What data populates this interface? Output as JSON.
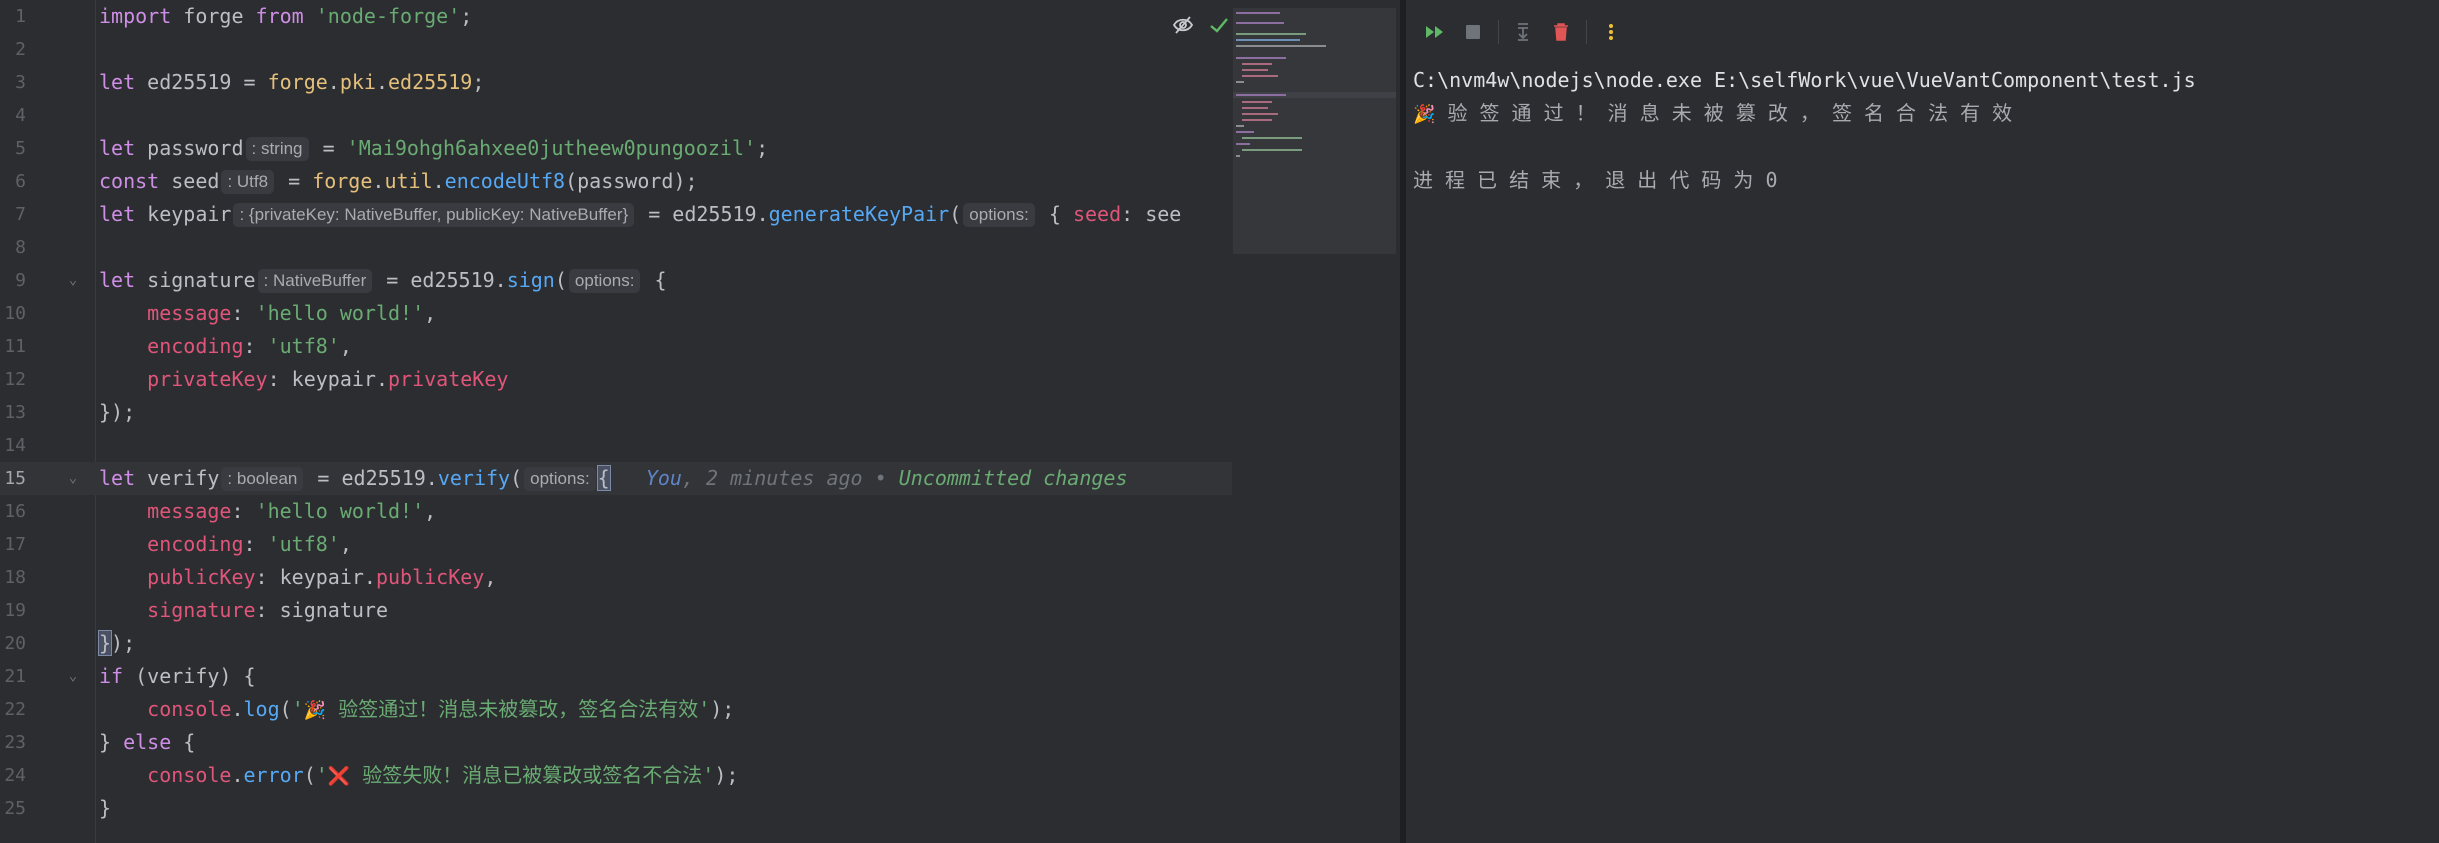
{
  "editor": {
    "line_numbers": [
      "1",
      "2",
      "3",
      "4",
      "5",
      "6",
      "7",
      "8",
      "9",
      "10",
      "11",
      "12",
      "13",
      "14",
      "15",
      "16",
      "17",
      "18",
      "19",
      "20",
      "21",
      "22",
      "23",
      "24",
      "25"
    ],
    "line1": {
      "kw1": "import",
      "id": " forge ",
      "kw2": "from",
      "sp": " ",
      "str": "'node-forge'",
      "end": ";"
    },
    "line3": {
      "kw": "let",
      "id": " ed25519 = ",
      "obj": "forge",
      "dot": ".",
      "prop1": "pki",
      "dot2": ".",
      "prop2": "ed25519",
      "end": ";"
    },
    "line5": {
      "kw": "let",
      "id": " password",
      "hint": ": string",
      "eq": " = ",
      "str": "'Mai9ohgh6ahxee0jutheew0pungoozil'",
      "end": ";"
    },
    "line6": {
      "kw": "const",
      "id": " seed",
      "hint": ": Utf8",
      "eq": " = ",
      "obj": "forge",
      "dot": ".",
      "prop": "util",
      "dot2": ".",
      "fn": "encodeUtf8",
      "args": "(password);"
    },
    "line7": {
      "kw": "let",
      "id": " keypair",
      "hint": ": {privateKey: NativeBuffer, publicKey: NativeBuffer}",
      "eq": " = ed25519.",
      "fn": "generateKeyPair",
      "open": "(",
      "hint2": "options:",
      "brace": " { ",
      "prop": "seed",
      "rest": ": see"
    },
    "line9": {
      "kw": "let",
      "id": " signature",
      "hint": ": NativeBuffer",
      "eq": " = ed25519.",
      "fn": "sign",
      "open": "(",
      "hint2": "options:",
      "brace": " {"
    },
    "line10": {
      "indent": "    ",
      "prop": "message",
      "colon": ": ",
      "str": "'hello world!'",
      "end": ","
    },
    "line11": {
      "indent": "    ",
      "prop": "encoding",
      "colon": ": ",
      "str": "'utf8'",
      "end": ","
    },
    "line12": {
      "indent": "    ",
      "prop": "privateKey",
      "colon": ": keypair.",
      "prop2": "privateKey"
    },
    "line13": {
      "text": "});"
    },
    "line15": {
      "kw": "let",
      "id": " verify",
      "hint": ": boolean",
      "eq": " = ed25519.",
      "fn": "verify",
      "open": "(",
      "hint2": "options:",
      "sp": " ",
      "brace": "{",
      "blame_who": "You",
      "blame_time": ", 2 minutes ago • ",
      "blame_msg": "Uncommitted changes"
    },
    "line16": {
      "indent": "    ",
      "prop": "message",
      "colon": ": ",
      "str": "'hello world!'",
      "end": ","
    },
    "line17": {
      "indent": "    ",
      "prop": "encoding",
      "colon": ": ",
      "str": "'utf8'",
      "end": ","
    },
    "line18": {
      "indent": "    ",
      "prop": "publicKey",
      "colon": ": keypair.",
      "prop2": "publicKey",
      "end": ","
    },
    "line19": {
      "indent": "    ",
      "prop": "signature",
      "colon": ": signature"
    },
    "line20": {
      "brace": "}",
      "end": ");"
    },
    "line21": {
      "kw": "if",
      "rest": " (verify) {"
    },
    "line22": {
      "indent": "    ",
      "obj": "console",
      "dot": ".",
      "fn": "log",
      "open": "(",
      "str_open": "'",
      "emoji": "🎉",
      "str": " 验签通过！消息未被篡改，签名合法有效'",
      "end": ");"
    },
    "line23": {
      "open": "} ",
      "kw": "else",
      "rest": " {"
    },
    "line24": {
      "indent": "    ",
      "obj": "console",
      "dot": ".",
      "fn": "error",
      "open": "(",
      "str_open": "'",
      "emoji": "❌",
      "str": " 验签失败！消息已被篡改或签名不合法'",
      "end": ");"
    },
    "line25": {
      "text": "}"
    },
    "icons": {
      "hide_inlays": "eye-slash-icon",
      "check": "check-icon"
    }
  },
  "run_panel": {
    "toolbar": [
      "rerun-icon",
      "stop-icon",
      "scroll-to-end-icon",
      "clear-all-icon",
      "more-icon"
    ],
    "output": {
      "command": "C:\\nvm4w\\nodejs\\node.exe E:\\selfWork\\vue\\VueVantComponent\\test.js",
      "emoji": "🎉",
      "message": " 验 签 通 过 ！ 消 息 未 被 篡 改 ， 签 名 合 法 有 效",
      "exit": "进 程 已 结 束 ， 退 出 代 码 为 0"
    }
  },
  "colors": {
    "background": "#2b2d30",
    "keyword": "#cf8ee6",
    "function": "#56a8f5",
    "property": "#e0557a",
    "string": "#6aab73",
    "module": "#e5c07b",
    "rerun": "#5fb865",
    "clear": "#e05555",
    "more": "#f0c132"
  }
}
